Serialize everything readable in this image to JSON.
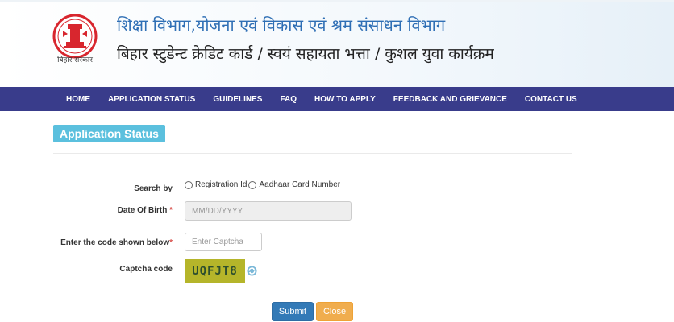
{
  "header": {
    "logo_caption": "बिहार सरकार",
    "department_title": "शिक्षा विभाग,योजना एवं विकास एवं श्रम संसाधन विभाग",
    "scheme_title": "बिहार स्टुडेन्ट क्रेडिट कार्ड / स्वयं सहायता भत्ता / कुशल युवा कार्यक्रम"
  },
  "nav": {
    "items": [
      "HOME",
      "APPLICATION STATUS",
      "GUIDELINES",
      "FAQ",
      "HOW TO APPLY",
      "FEEDBACK AND GRIEVANCE",
      "CONTACT US"
    ]
  },
  "page": {
    "title": "Application Status"
  },
  "form": {
    "search_by_label": "Search by",
    "radio_registration": "Registration Id",
    "radio_aadhaar": "Aadhaar Card Number",
    "dob_label": "Date Of Birth",
    "dob_required": "*",
    "dob_placeholder": "MM/DD/YYYY",
    "captcha_input_label": "Enter the code shown below",
    "captcha_required": "*",
    "captcha_placeholder": "Enter Captcha",
    "captcha_code_label": "Captcha code",
    "captcha_value": "UQFJT8"
  },
  "buttons": {
    "submit": "Submit",
    "close": "Close"
  },
  "colors": {
    "nav_bg": "#393c8b",
    "badge_bg": "#5bc0de",
    "submit_bg": "#337ab7",
    "close_bg": "#f0ad4e",
    "captcha_bg": "#b5b52a"
  }
}
